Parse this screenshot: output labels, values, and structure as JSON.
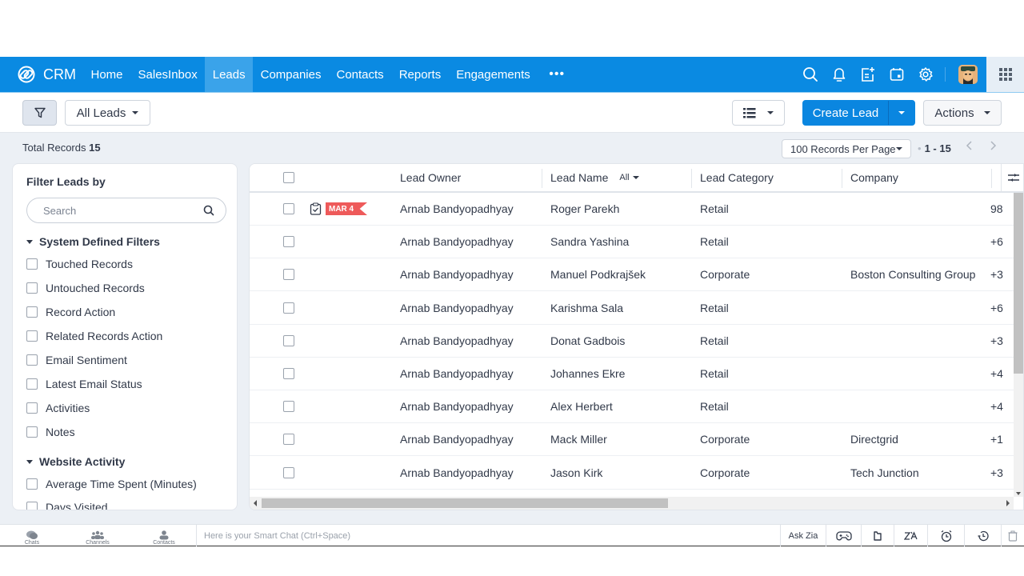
{
  "app": {
    "brand": "CRM"
  },
  "nav": {
    "items": [
      {
        "label": "Home",
        "active": false
      },
      {
        "label": "SalesInbox",
        "active": false
      },
      {
        "label": "Leads",
        "active": true
      },
      {
        "label": "Companies",
        "active": false
      },
      {
        "label": "Contacts",
        "active": false
      },
      {
        "label": "Reports",
        "active": false
      },
      {
        "label": "Engagements",
        "active": false
      }
    ],
    "more": "•••",
    "right_icons": [
      "search-icon",
      "bell-icon",
      "add-note-icon",
      "calendar-icon",
      "gear-icon",
      "avatar",
      "apps-grid-icon"
    ]
  },
  "toolbar": {
    "view_selector": "All Leads",
    "create_button": "Create Lead",
    "actions_button": "Actions"
  },
  "summary": {
    "total_label": "Total Records",
    "total_count": "15",
    "per_page": "100 Records Per Page",
    "range": "1 - 15"
  },
  "sidebar": {
    "title": "Filter Leads by",
    "search_placeholder": "Search",
    "sections": [
      {
        "title": "System Defined Filters",
        "items": [
          "Touched Records",
          "Untouched Records",
          "Record Action",
          "Related Records Action",
          "Email Sentiment",
          "Latest Email Status",
          "Activities",
          "Notes"
        ]
      },
      {
        "title": "Website Activity",
        "items": [
          "Average Time Spent (Minutes)",
          "Days Visited"
        ]
      }
    ]
  },
  "table": {
    "columns": {
      "owner": "Lead Owner",
      "name": "Lead Name",
      "name_filter": "All",
      "category": "Lead Category",
      "company": "Company"
    },
    "rows": [
      {
        "tag": "MAR 4",
        "owner": "Arnab Bandyopadhyay",
        "name": "Roger Parekh",
        "category": "Retail",
        "company": "",
        "phone": "98"
      },
      {
        "tag": "",
        "owner": "Arnab Bandyopadhyay",
        "name": "Sandra Yashina",
        "category": "Retail",
        "company": "",
        "phone": "+6"
      },
      {
        "tag": "",
        "owner": "Arnab Bandyopadhyay",
        "name": "Manuel Podkrajšek",
        "category": "Corporate",
        "company": "Boston Consulting Group",
        "phone": "+3"
      },
      {
        "tag": "",
        "owner": "Arnab Bandyopadhyay",
        "name": "Karishma Sala",
        "category": "Retail",
        "company": "",
        "phone": "+6"
      },
      {
        "tag": "",
        "owner": "Arnab Bandyopadhyay",
        "name": "Donat Gadbois",
        "category": "Retail",
        "company": "",
        "phone": "+3"
      },
      {
        "tag": "",
        "owner": "Arnab Bandyopadhyay",
        "name": "Johannes Ekre",
        "category": "Retail",
        "company": "",
        "phone": "+4"
      },
      {
        "tag": "",
        "owner": "Arnab Bandyopadhyay",
        "name": "Alex Herbert",
        "category": "Retail",
        "company": "",
        "phone": "+4"
      },
      {
        "tag": "",
        "owner": "Arnab Bandyopadhyay",
        "name": "Mack Miller",
        "category": "Corporate",
        "company": "Directgrid",
        "phone": "+1"
      },
      {
        "tag": "",
        "owner": "Arnab Bandyopadhyay",
        "name": "Jason Kirk",
        "category": "Corporate",
        "company": "Tech Junction",
        "phone": "+3"
      }
    ]
  },
  "bottombar": {
    "tabs": [
      "Chats",
      "Channels",
      "Contacts"
    ],
    "smartchat_placeholder": "Here is your Smart Chat (Ctrl+Space)",
    "ask_zia": "Ask Zia"
  },
  "colors": {
    "nav_bg": "#0a8ae2",
    "nav_active": "#3aa3ea",
    "primary_button": "#0a86e0",
    "tag_red": "#ee5a5a"
  }
}
